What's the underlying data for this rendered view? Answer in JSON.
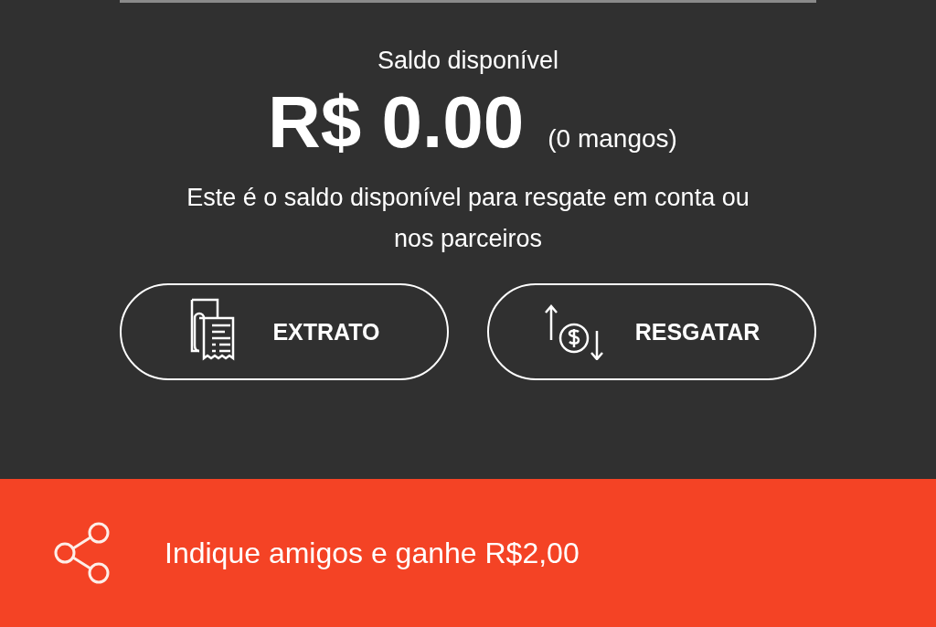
{
  "balance": {
    "label": "Saldo disponível",
    "amount": "R$ 0.00",
    "note": "(0 mangos)",
    "description": "Este é o saldo disponível para resgate em conta ou nos parceiros"
  },
  "actions": [
    {
      "kind": "statement",
      "label": "EXTRATO"
    },
    {
      "kind": "redeem",
      "label": "RESGATAR"
    }
  ],
  "referral": {
    "text": "Indique amigos e ganhe R$2,00"
  }
}
